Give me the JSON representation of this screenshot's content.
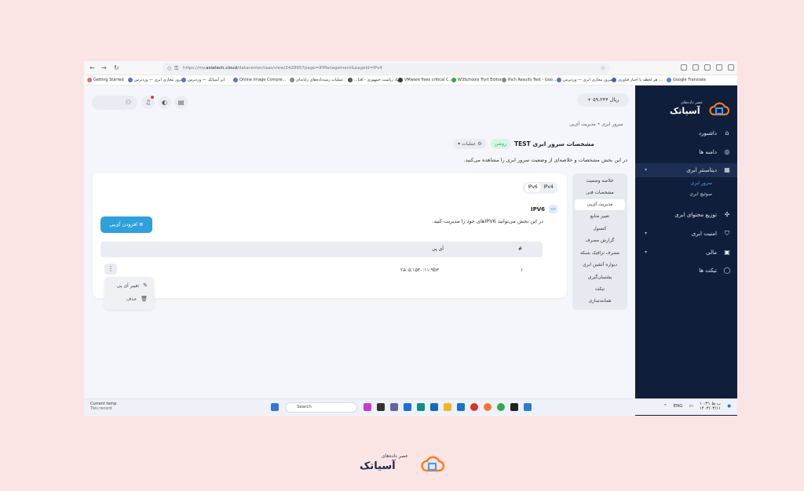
{
  "browser": {
    "url_prefix": "https://my.",
    "url_domain": "asiatech.cloud",
    "url_rest": "/datacenter/iaas/view/2428857page=IPManagement&pageId=IPv4",
    "bookmarks": [
      "Getting Started",
      "سرور مجازی ابری — وردپرس",
      "ابر آسیاتک — وردپرس",
      "Online Image Compre...",
      "عملیات رشدداده‌های رایانه‌ای",
      "...نهاد ریاست جمهوری - اقتا",
      "VMware fixes critical C...",
      "W3Schools Tryit Editor",
      "Rich Results Test - Goo...",
      "سرور مجازی ابری — وردپرس",
      "هر لحظه با اخبار فناوری ...",
      "Google Translate"
    ]
  },
  "sidebar": {
    "logo_text": "آسیاتک",
    "logo_sub": "عصر داده‌های",
    "items": [
      {
        "label": "داشبورد",
        "icon": "home-icon"
      },
      {
        "label": "دامنه ها",
        "icon": "globe-icon"
      },
      {
        "label": "دیتاسنتر ابری",
        "icon": "building-icon"
      },
      {
        "label": "توزیع محتوای ابری",
        "icon": "network-icon"
      },
      {
        "label": "امنیت ابری",
        "icon": "shield-icon"
      },
      {
        "label": "مالی",
        "icon": "wallet-icon"
      },
      {
        "label": "تیکت ها",
        "icon": "chat-icon"
      }
    ],
    "sub_items": [
      "سرور ابری",
      "سوئیچ ابری"
    ]
  },
  "header": {
    "balance": "+ ۵۹،۲۴۴ ریال"
  },
  "breadcrumb": "سرور ابری  •  مدیریت آی‌پی",
  "page": {
    "title": "مشخصات سرور ابری  TEST",
    "status": "روشن",
    "ops_label": "عملیات",
    "description": "در این بخش مشخصات و خلاصه‌ای از وضعیت سرور ابری را مشاهده می‌کنید."
  },
  "tabs": [
    "خلاصه وضعیت",
    "مشخصات فنی",
    "مدیریت آی‌پی",
    "تغییر منابع",
    "کنسول",
    "گزارش مصرف",
    "مصرف ترافیک شبکه",
    "دیواره آتشین ابری",
    "پشتیبان‌گیری",
    "تیکت",
    "همانندسازی"
  ],
  "ip": {
    "versions": [
      "IPv6",
      "IPv4"
    ],
    "section_title": "IPV6",
    "section_desc": "در این بخش می‌توانید IPV6‌های خود را مدیریت کنید.",
    "add_button": "افزودن آی‌پی",
    "columns": [
      "#",
      "آی پی"
    ],
    "rows": [
      {
        "index": "۱",
        "ip": "۲a۰۵:۱۵۳۰:۱۱:۹b۳"
      }
    ],
    "menu": {
      "edit": "تغییر آی پی",
      "delete": "حذف"
    }
  },
  "taskbar": {
    "temp_title": "Current temp",
    "temp_sub": "Ties record",
    "search": "Search",
    "lang": "ENG",
    "time": "۱۰:۳۱ ب.ظ",
    "date": "۱۴۰۳/۰۳/۱۱"
  },
  "footer": {
    "logo_text": "آسیاتک",
    "logo_sub": "عصر داده‌های"
  }
}
